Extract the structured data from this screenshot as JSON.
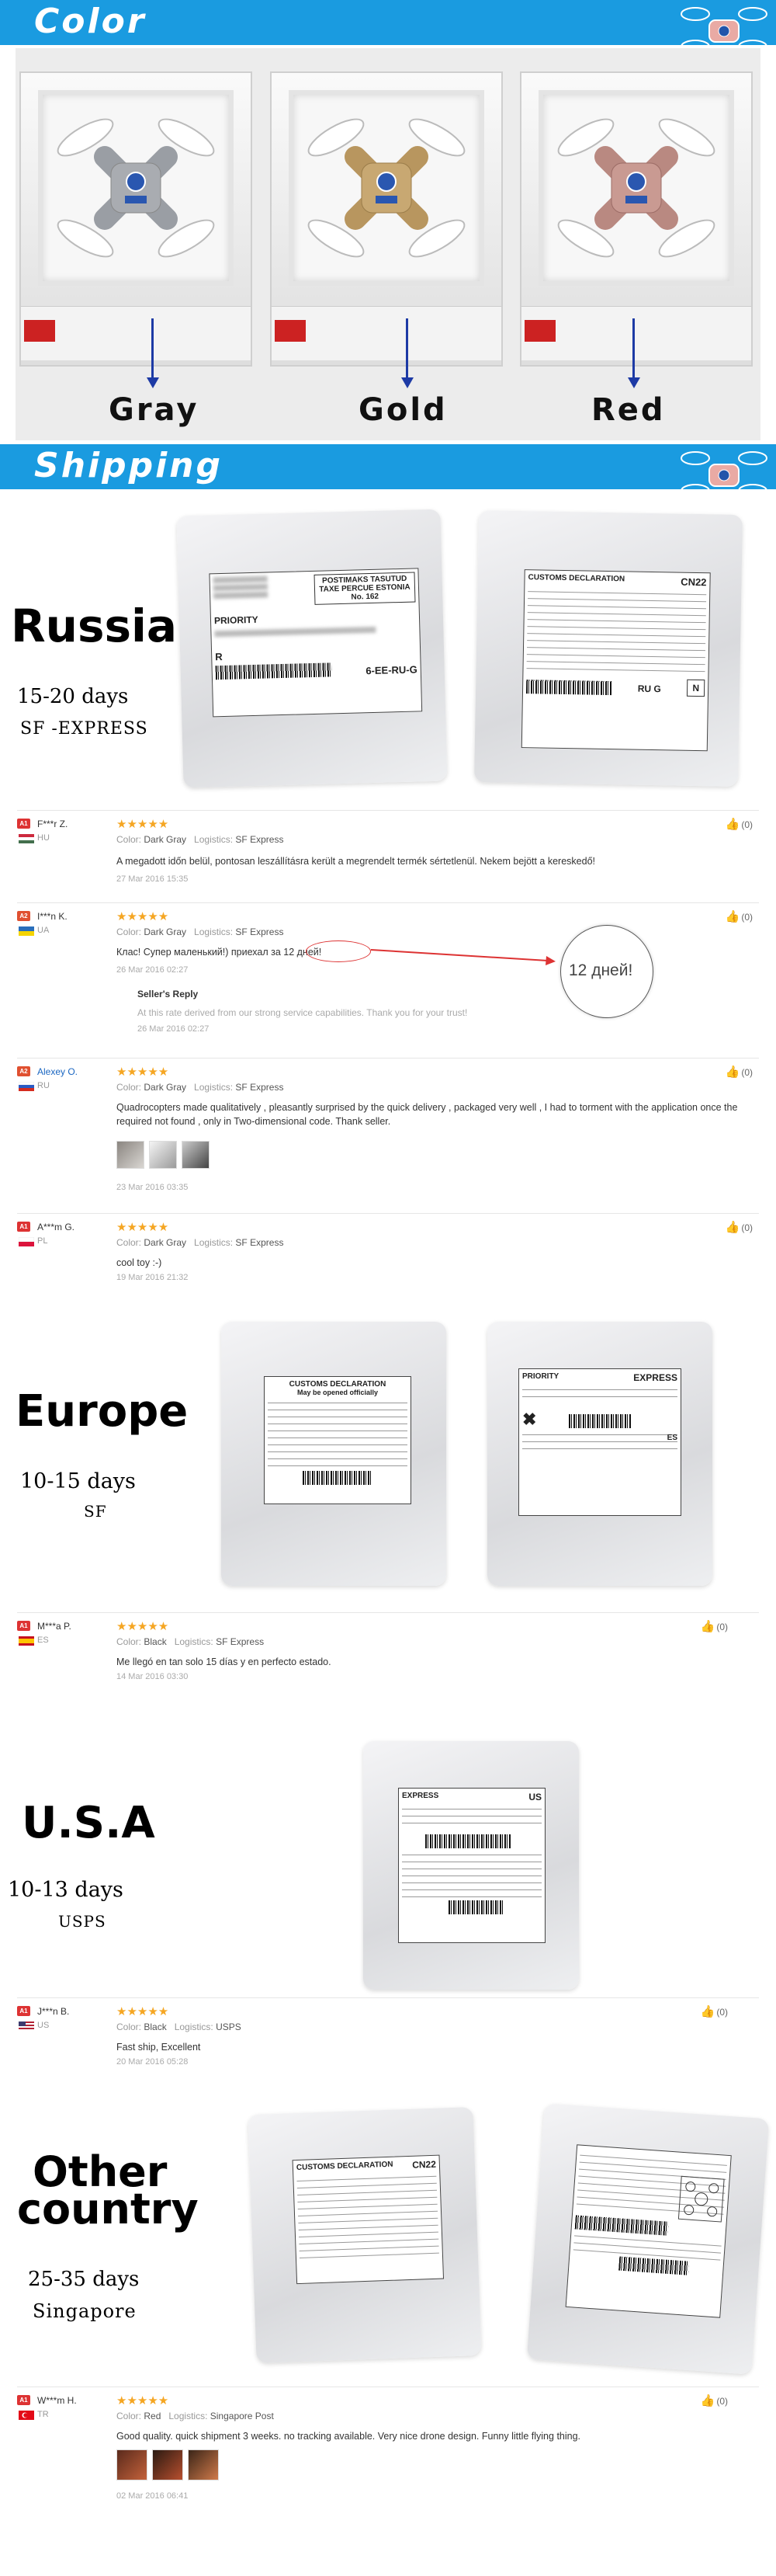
{
  "sections": {
    "color_banner": {
      "title": "Color"
    },
    "shipping_banner": {
      "title": "Shipping"
    }
  },
  "colors": [
    {
      "name": "Gray",
      "shell": "#a9acb1"
    },
    {
      "name": "Gold",
      "shell": "#c8a872"
    },
    {
      "name": "Red",
      "shell": "#c99a92"
    }
  ],
  "regions": [
    {
      "name": "Russia",
      "days": "15-20 days",
      "carrier": "SF -EXPRESS"
    },
    {
      "name": "Europe",
      "days": "10-15 days",
      "carrier": "SF"
    },
    {
      "name": "U.S.A",
      "days": "10-13 days",
      "carrier": "USPS"
    },
    {
      "name_line1": "Other",
      "name_line2": "country",
      "days": "25-35 days",
      "carrier": "Singapore"
    }
  ],
  "labels": {
    "posti": "POSTIMAKS TASUTUD TAXE PERCUE ESTONIA No. 162",
    "priority": "PRIORITY",
    "r_mark": "R",
    "tracking_ru": "6-EE-RU-G",
    "customs": "CUSTOMS DECLARATION",
    "cn22": "CN22",
    "ru_g": "RU G",
    "n_mark": "N",
    "customs_eu": "CUSTOMS DECLARATION",
    "customs_eu_sub": "May be opened officially",
    "sf_express": "EXPRESS",
    "es_mark": "ES",
    "us_mark": "US",
    "cn22_other": "CN22"
  },
  "reviews": [
    {
      "rank": "A1",
      "name": "F***r Z.",
      "country": "HU",
      "stars": "★★★★★",
      "color_label": "Color:",
      "color": "Dark Gray",
      "logistics_label": "Logistics:",
      "logistics": "SF Express",
      "text": "A megadott időn belül, pontosan leszállításra került a megrendelt termék sértetlenül. Nekem bejött a kereskedő!",
      "date": "27 Mar 2016 15:35",
      "helpful": "(0)"
    },
    {
      "rank": "A2",
      "name": "I***n K.",
      "country": "UA",
      "stars": "★★★★★",
      "color_label": "Color:",
      "color": "Dark Gray",
      "logistics_label": "Logistics:",
      "logistics": "SF Express",
      "text": "Клас! Супер маленький!) приехал за 12 дней!",
      "date": "26 Mar 2016 02:27",
      "seller_title": "Seller's Reply",
      "seller_text": "At this rate derived from our strong service capabilities. Thank you for your trust!",
      "seller_date": "26 Mar 2016 02:27",
      "callout": "12 дней!",
      "helpful": "(0)"
    },
    {
      "rank": "A2",
      "name": "Alexey O.",
      "country": "RU",
      "stars": "★★★★★",
      "color_label": "Color:",
      "color": "Dark Gray",
      "logistics_label": "Logistics:",
      "logistics": "SF Express",
      "text": "Quadrocopters made qualitatively , pleasantly surprised by the quick delivery , packaged very well , I had to torment with the application once the required not found , only in Two-dimensional code. Thank seller.",
      "date": "23 Mar 2016 03:35",
      "helpful": "(0)"
    },
    {
      "rank": "A1",
      "name": "A***m G.",
      "country": "PL",
      "stars": "★★★★★",
      "color_label": "Color:",
      "color": "Dark Gray",
      "logistics_label": "Logistics:",
      "logistics": "SF Express",
      "text": "cool toy :-)",
      "date": "19 Mar 2016 21:32",
      "helpful": "(0)"
    },
    {
      "rank": "A1",
      "name": "M***a P.",
      "country": "ES",
      "stars": "★★★★★",
      "color_label": "Color:",
      "color": "Black",
      "logistics_label": "Logistics:",
      "logistics": "SF Express",
      "text": "Me llegó en tan solo 15 días y en perfecto estado.",
      "date": "14 Mar 2016 03:30",
      "helpful": "(0)"
    },
    {
      "rank": "A1",
      "name": "J***n B.",
      "country": "US",
      "stars": "★★★★★",
      "color_label": "Color:",
      "color": "Black",
      "logistics_label": "Logistics:",
      "logistics": "USPS",
      "text": "Fast ship, Excellent",
      "date": "20 Mar 2016 05:28",
      "helpful": "(0)"
    },
    {
      "rank": "A1",
      "name": "W***m H.",
      "country": "TR",
      "stars": "★★★★★",
      "color_label": "Color:",
      "color": "Red",
      "logistics_label": "Logistics:",
      "logistics": "Singapore Post",
      "text": "Good quality. quick shipment 3 weeks. no tracking available. Very nice drone design. Funny little flying thing.",
      "date": "02 Mar 2016 06:41",
      "helpful": "(0)"
    }
  ]
}
